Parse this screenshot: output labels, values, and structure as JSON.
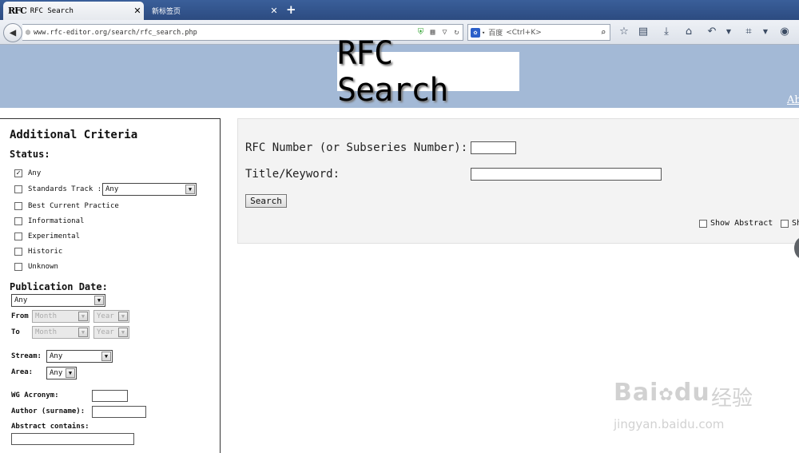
{
  "browser": {
    "tabs": [
      {
        "favicon": "RFC",
        "title": "RFC Search",
        "close": "✕"
      },
      {
        "title": "新标签页",
        "close": "✕"
      }
    ],
    "new_tab": "+",
    "url": "www.rfc-editor.org/search/rfc_search.php",
    "search_engine": "百度",
    "search_placeholder": "<Ctrl+K>"
  },
  "banner": {
    "logo": "RFC Search",
    "about_link": "Ab"
  },
  "criteria": {
    "title": "Additional Criteria",
    "status_label": "Status:",
    "status_options": [
      {
        "label": "Any",
        "checked": true
      },
      {
        "label": "Standards Track ::",
        "checked": false
      },
      {
        "label": "Best Current Practice",
        "checked": false
      },
      {
        "label": "Informational",
        "checked": false
      },
      {
        "label": "Experimental",
        "checked": false
      },
      {
        "label": "Historic",
        "checked": false
      },
      {
        "label": "Unknown",
        "checked": false
      }
    ],
    "standards_track_select": "Any",
    "pub_date_label": "Publication Date:",
    "pub_date_select": "Any",
    "from_label": "From",
    "to_label": "To",
    "month_placeholder": "Month",
    "year_placeholder": "Year",
    "stream_label": "Stream:",
    "stream_select": "Any",
    "area_label": "Area:",
    "area_select": "Any",
    "wg_label": "WG Acronym:",
    "author_label": "Author (surname):",
    "abstract_label": "Abstract contains:"
  },
  "main": {
    "rfc_number_label": "RFC Number (or Subseries Number):",
    "title_keyword_label": "Title/Keyword:",
    "search_button": "Search",
    "show_abstract": "Show Abstract",
    "show_second": "Sh"
  },
  "watermark": {
    "brand": "Bai",
    "brand_tail": "du",
    "cn": "经验",
    "url": "jingyan.baidu.com"
  }
}
